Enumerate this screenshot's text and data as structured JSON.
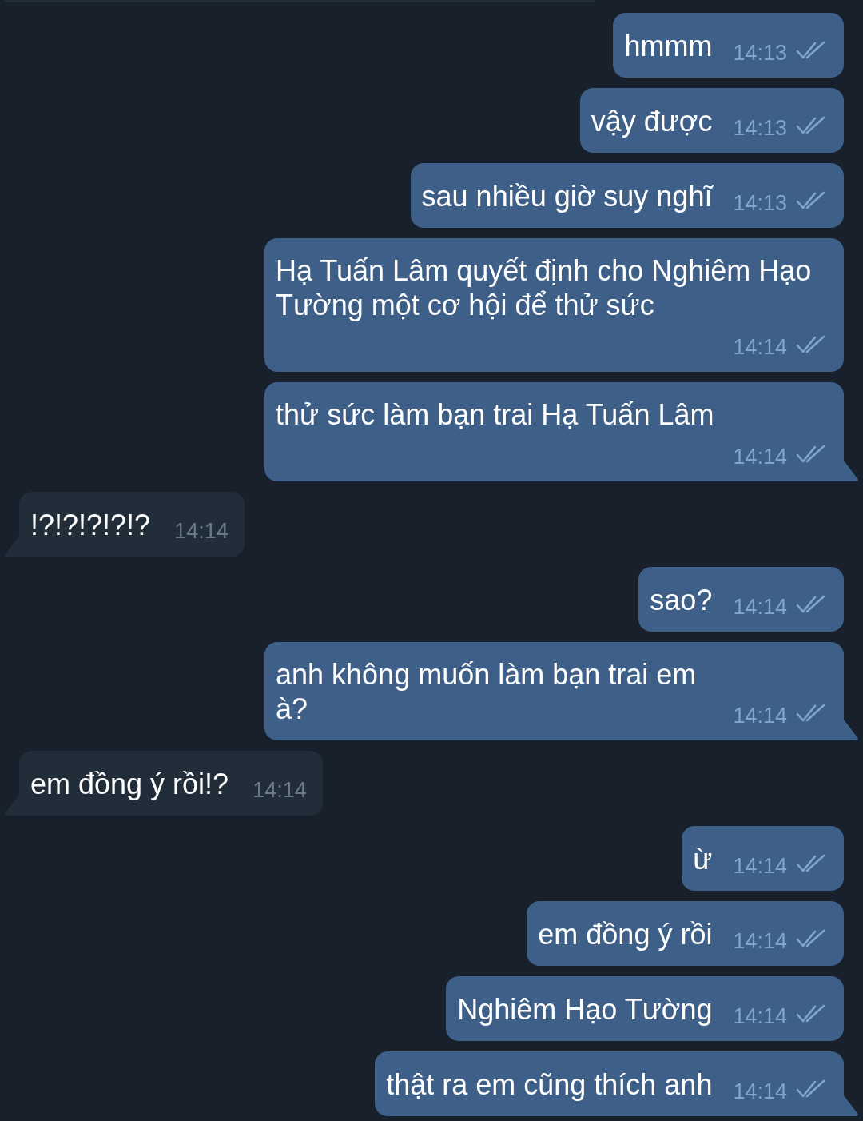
{
  "clipped_message_above": {
    "kind": "incoming"
  },
  "messages": [
    {
      "kind": "outgoing",
      "text": "hmmm",
      "time": "14:13",
      "read": true,
      "tail": false
    },
    {
      "kind": "outgoing",
      "text": "vậy được",
      "time": "14:13",
      "read": true,
      "tail": false
    },
    {
      "kind": "outgoing",
      "text": "sau nhiều giờ suy nghĩ",
      "time": "14:13",
      "read": true,
      "tail": false
    },
    {
      "kind": "outgoing",
      "text": "Hạ Tuấn Lâm quyết định cho Nghiêm Hạo Tường một cơ hội để thử sức",
      "time": "14:14",
      "read": true,
      "tail": false
    },
    {
      "kind": "outgoing",
      "text": "thử sức làm bạn trai Hạ Tuấn Lâm",
      "time": "14:14",
      "read": true,
      "tail": true
    },
    {
      "kind": "incoming",
      "text": "!?!?!?!?!?",
      "time": "14:14",
      "tail": true
    },
    {
      "kind": "outgoing",
      "text": "sao?",
      "time": "14:14",
      "read": true,
      "tail": false
    },
    {
      "kind": "outgoing",
      "text": "anh không muốn làm bạn trai em\nà?",
      "time": "14:14",
      "read": true,
      "tail": true
    },
    {
      "kind": "incoming",
      "text": "em đồng ý rồi!?",
      "time": "14:14",
      "tail": true
    },
    {
      "kind": "outgoing",
      "text": "ừ",
      "time": "14:14",
      "read": true,
      "tail": false
    },
    {
      "kind": "outgoing",
      "text": "em đồng ý rồi",
      "time": "14:14",
      "read": true,
      "tail": false
    },
    {
      "kind": "outgoing",
      "text": "Nghiêm Hạo Tường",
      "time": "14:14",
      "read": true,
      "tail": false
    },
    {
      "kind": "outgoing",
      "text": "thật ra em cũng thích anh",
      "time": "14:14",
      "read": true,
      "tail": true
    }
  ]
}
